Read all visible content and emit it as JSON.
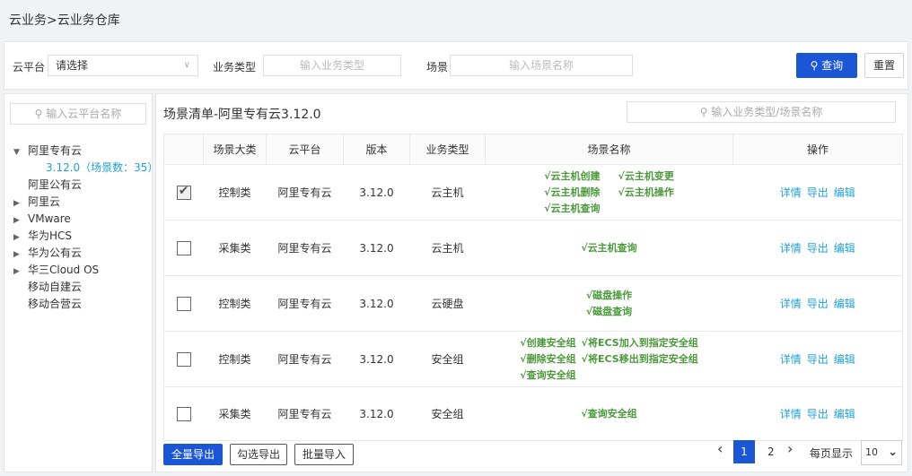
{
  "breadcrumb": {
    "text": "云业务>云业务仓库"
  },
  "filters": {
    "cloud_label": "云平台",
    "cloud_value": "请选择",
    "type_label": "业务类型",
    "type_placeholder": "输入业务类型",
    "scene_label": "场景",
    "scene_placeholder": "输入场景名称",
    "search_button": "查询",
    "reset_button": "重置"
  },
  "sidebar": {
    "search_placeholder": "输入云平台名称",
    "tree": [
      {
        "label": "阿里专有云",
        "state": "expanded"
      },
      {
        "label": "3.12.0（场景数：35）",
        "state": "child-selected"
      },
      {
        "label": "阿里公有云",
        "state": "leaf"
      },
      {
        "label": "阿里云",
        "state": "collapsed"
      },
      {
        "label": "VMware",
        "state": "collapsed"
      },
      {
        "label": "华为HCS",
        "state": "collapsed"
      },
      {
        "label": "华为公有云",
        "state": "collapsed"
      },
      {
        "label": "华三Cloud OS",
        "state": "collapsed"
      },
      {
        "label": "移动自建云",
        "state": "leaf"
      },
      {
        "label": "移动合营云",
        "state": "leaf"
      }
    ]
  },
  "main": {
    "title": "场景清单-阿里专有云3.12.0",
    "search_placeholder": "输入业务类型/场景名称",
    "columns": [
      "",
      "场景大类",
      "云平台",
      "版本",
      "业务类型",
      "场景名称",
      "操作"
    ],
    "rows": [
      {
        "checked": true,
        "category": "控制类",
        "cloud": "阿里专有云",
        "version": "3.12.0",
        "biz_type": "云主机",
        "scenes": [
          "√云主机创建",
          "√云主机变更",
          "√云主机删除",
          "√云主机操作",
          "√云主机查询"
        ]
      },
      {
        "checked": false,
        "category": "采集类",
        "cloud": "阿里专有云",
        "version": "3.12.0",
        "biz_type": "云主机",
        "scenes": [
          "√云主机查询"
        ]
      },
      {
        "checked": false,
        "category": "控制类",
        "cloud": "阿里专有云",
        "version": "3.12.0",
        "biz_type": "云硬盘",
        "scenes": [
          "√磁盘操作",
          "√磁盘查询"
        ]
      },
      {
        "checked": false,
        "category": "控制类",
        "cloud": "阿里专有云",
        "version": "3.12.0",
        "biz_type": "安全组",
        "scenes": [
          "√创建安全组",
          "√将ECS加入到指定安全组",
          "√删除安全组",
          "√将ECS移出到指定安全组",
          "√查询安全组"
        ]
      },
      {
        "checked": false,
        "category": "采集类",
        "cloud": "阿里专有云",
        "version": "3.12.0",
        "biz_type": "安全组",
        "scenes": [
          "√查询安全组"
        ]
      }
    ],
    "ops": [
      "详情",
      "导出",
      "编辑"
    ],
    "footer_buttons": {
      "export_all": "全量导出",
      "export_checked": "勾选导出",
      "batch_import": "批量导入"
    },
    "pagination": {
      "pages": [
        "1",
        "2"
      ],
      "current": "1",
      "per_page_label": "每页显示",
      "per_page_value": "10"
    }
  },
  "colors": {
    "primary": "#1a56d6",
    "link": "#1fa2d9",
    "scene_green": "#4a9a3a"
  }
}
